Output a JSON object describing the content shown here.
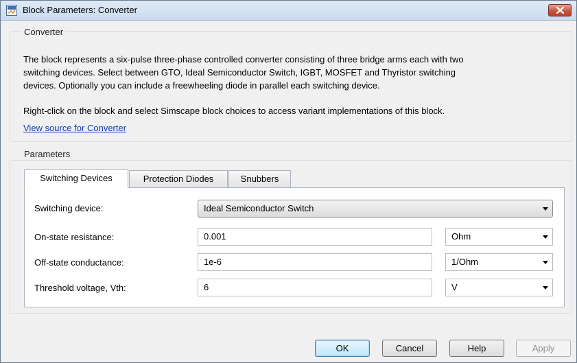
{
  "window": {
    "title": "Block Parameters: Converter"
  },
  "block": {
    "group_label": "Converter",
    "description_lines": [
      "The block represents a six-pulse three-phase controlled converter consisting of three bridge arms each with two",
      "switching devices. Select between GTO, Ideal Semiconductor Switch, IGBT, MOSFET and Thyristor switching",
      "devices. Optionally you can include a freewheeling diode in parallel each switching device."
    ],
    "note": "Right-click on the block and select Simscape block choices to access variant implementations of this block.",
    "source_link": "View source for Converter"
  },
  "parameters": {
    "group_label": "Parameters",
    "tabs": [
      {
        "label": "Switching Devices",
        "active": true
      },
      {
        "label": "Protection Diodes",
        "active": false
      },
      {
        "label": "Snubbers",
        "active": false
      }
    ],
    "switching_device": {
      "label": "Switching device:",
      "value": "Ideal Semiconductor Switch"
    },
    "rows": [
      {
        "label": "On-state resistance:",
        "value": "0.001",
        "unit": "Ohm"
      },
      {
        "label": "Off-state conductance:",
        "value": "1e-6",
        "unit": "1/Ohm"
      },
      {
        "label": "Threshold voltage, Vth:",
        "value": "6",
        "unit": "V"
      }
    ]
  },
  "buttons": {
    "ok": "OK",
    "cancel": "Cancel",
    "help": "Help",
    "apply": "Apply"
  },
  "icons": {
    "app": "simulink-block-icon",
    "close": "close-icon",
    "dropdown": "chevron-down-icon"
  },
  "colors": {
    "titlebar": "#c9daee",
    "close": "#c75641",
    "link": "#0b3fb0",
    "dialog_bg": "#f0f0f0"
  }
}
